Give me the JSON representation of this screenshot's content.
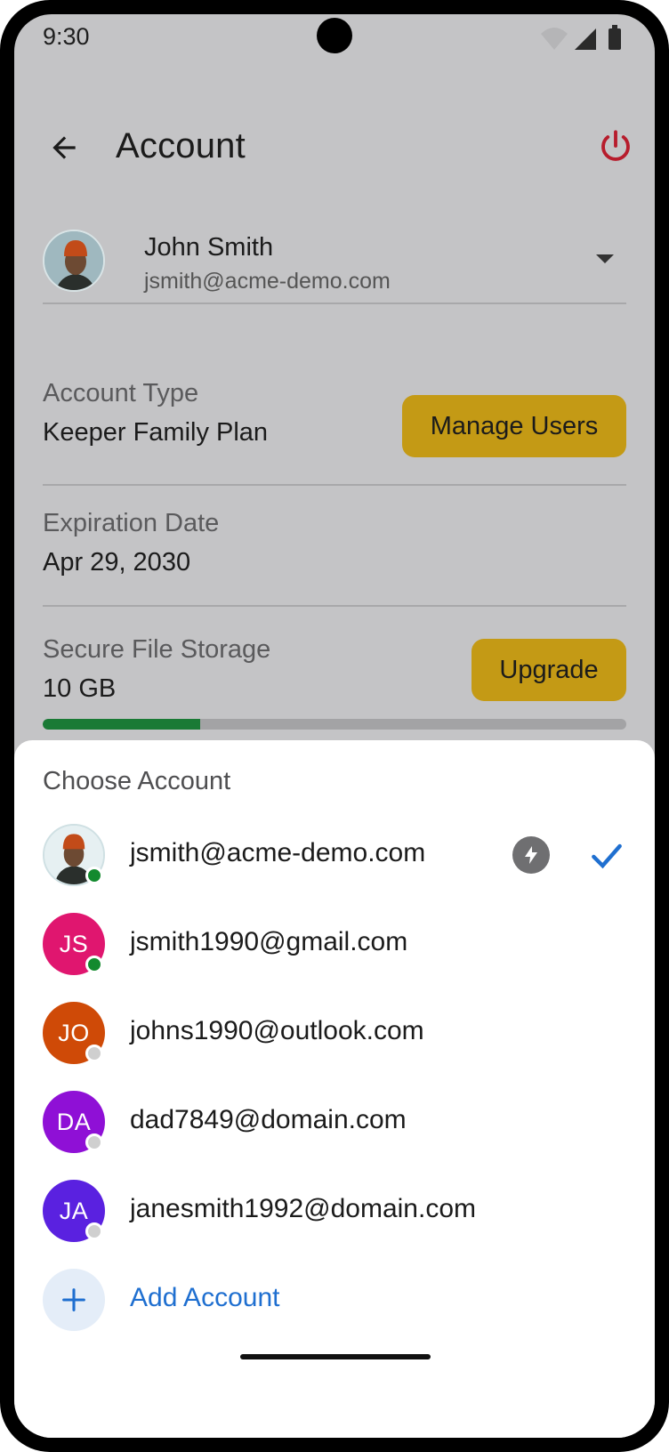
{
  "status_bar": {
    "time": "9:30"
  },
  "app_bar": {
    "title": "Account"
  },
  "account": {
    "name": "John Smith",
    "email": "jsmith@acme-demo.com"
  },
  "info": {
    "account_type_label": "Account Type",
    "account_type_value": "Keeper Family Plan",
    "manage_users_label": "Manage Users",
    "expiration_label": "Expiration Date",
    "expiration_value": "Apr 29, 2030",
    "storage_label": "Secure File Storage",
    "storage_value": "10 GB",
    "upgrade_label": "Upgrade",
    "storage_used_fraction": 0.27
  },
  "sheet": {
    "title": "Choose Account",
    "accounts": [
      {
        "email": "jsmith@acme-demo.com",
        "initials": "",
        "avatar_color": "#9fb8bf",
        "status": "online",
        "selected": true
      },
      {
        "email": "jsmith1990@gmail.com",
        "initials": "JS",
        "avatar_color": "#e0166f",
        "status": "online",
        "selected": false
      },
      {
        "email": "johns1990@outlook.com",
        "initials": "JO",
        "avatar_color": "#cf4a07",
        "status": "offline",
        "selected": false
      },
      {
        "email": "dad7849@domain.com",
        "initials": "DA",
        "avatar_color": "#8f10d6",
        "status": "offline",
        "selected": false
      },
      {
        "email": "janesmith1992@domain.com",
        "initials": "JA",
        "avatar_color": "#5a21e0",
        "status": "offline",
        "selected": false
      }
    ],
    "add_account_label": "Add Account"
  },
  "colors": {
    "accent_blue": "#1f6fd0",
    "button_gold": "#c49a15",
    "online_green": "#138a2e",
    "offline_gray": "#cfcfcf",
    "power_red": "#b71c2c"
  }
}
